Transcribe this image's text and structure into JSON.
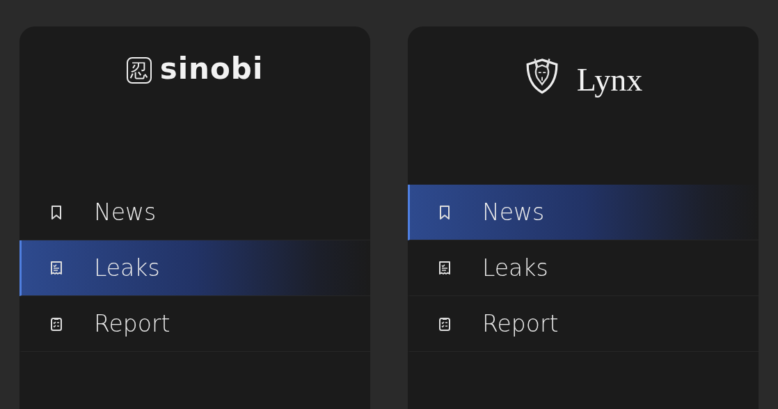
{
  "panels": [
    {
      "logo": {
        "kind": "sinobi",
        "seal": "忍",
        "text": "sinobi"
      },
      "items": [
        {
          "kind": "bookmark",
          "label": "News",
          "selected": false
        },
        {
          "kind": "receipt",
          "label": "Leaks",
          "selected": true
        },
        {
          "kind": "clipboard",
          "label": "Report",
          "selected": false
        }
      ]
    },
    {
      "logo": {
        "kind": "shield",
        "text": "Lynx"
      },
      "items": [
        {
          "kind": "bookmark",
          "label": "News",
          "selected": true
        },
        {
          "kind": "receipt",
          "label": "Leaks",
          "selected": false
        },
        {
          "kind": "clipboard",
          "label": "Report",
          "selected": false
        }
      ]
    }
  ]
}
